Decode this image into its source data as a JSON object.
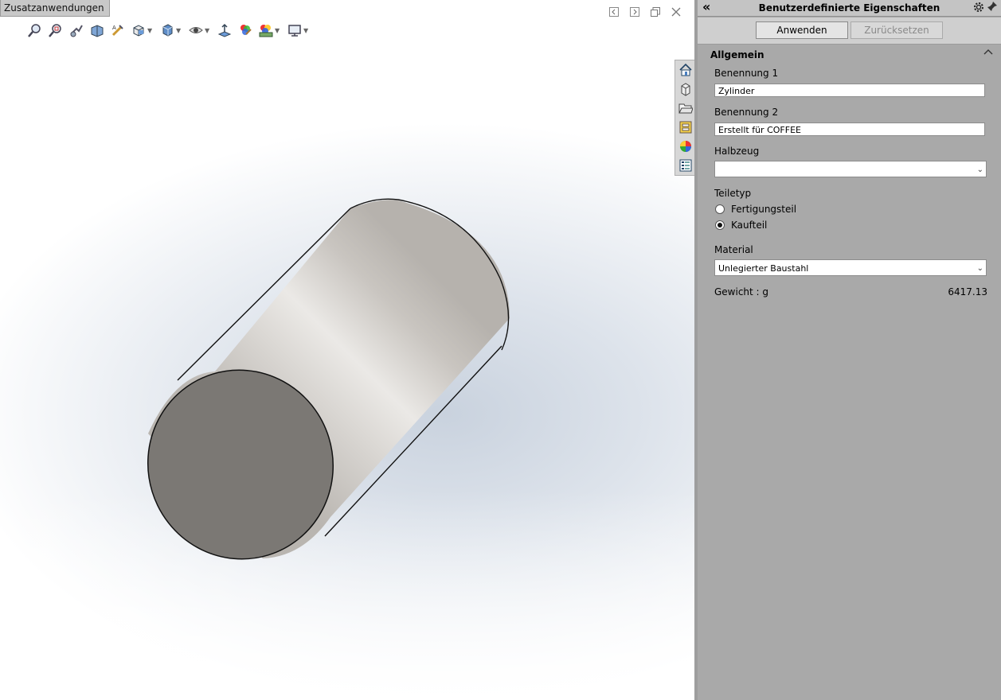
{
  "tab": {
    "label": "Zusatzanwendungen"
  },
  "hud_icons": [
    "zoom-to-fit-icon",
    "zoom-area-icon",
    "previous-view-icon",
    "section-view-icon",
    "dynamic-annotation-icon",
    "view-orientation-icon",
    "display-style-icon",
    "hide-show-icon",
    "edit-appearance-icon",
    "scene-icon",
    "view-settings-icon"
  ],
  "window_controls": [
    "tile-left-icon",
    "tile-right-icon",
    "restore-icon",
    "close-icon"
  ],
  "view_side_tabs": [
    "home-icon",
    "part-icon",
    "folder-icon",
    "properties-icon",
    "appearance-icon",
    "custom-properties-icon"
  ],
  "panel": {
    "title": "Benutzerdefinierte Eigenschaften",
    "apply_label": "Anwenden",
    "reset_label": "Zurücksetzen",
    "section_label": "Allgemein",
    "fields": {
      "benennung1_label": "Benennung 1",
      "benennung1_value": "Zylinder",
      "benennung2_label": "Benennung 2",
      "benennung2_value": "Erstellt für COFFEE",
      "halbzeug_label": "Halbzeug",
      "halbzeug_value": "",
      "teiletyp_label": "Teiletyp",
      "teiletyp_options": [
        "Fertigungsteil",
        "Kaufteil"
      ],
      "teiletyp_selected": "Kaufteil",
      "material_label": "Material",
      "material_value": "Unlegierter Baustahl",
      "gewicht_label": "Gewicht : g",
      "gewicht_value": "6417.13"
    }
  },
  "colors": {
    "panel_bg": "#a9a9a9",
    "cylinder_face": "#7b7874",
    "cylinder_body": "#c8c4bf"
  }
}
